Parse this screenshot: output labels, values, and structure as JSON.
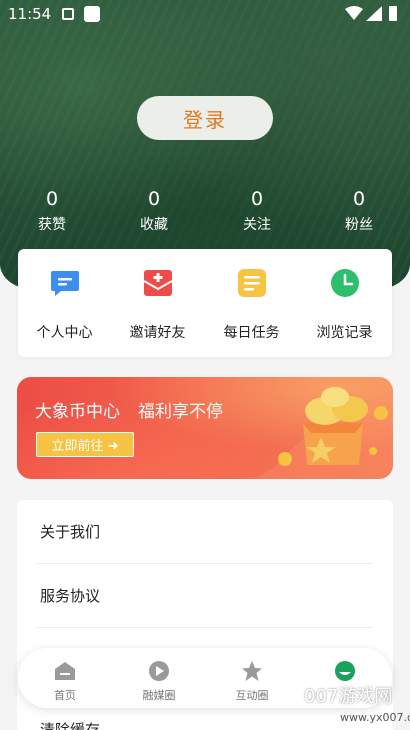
{
  "status_bar": {
    "time": "11:54"
  },
  "header": {
    "login_label": "登录",
    "stats": [
      {
        "value": "0",
        "label": "获赞"
      },
      {
        "value": "0",
        "label": "收藏"
      },
      {
        "value": "0",
        "label": "关注"
      },
      {
        "value": "0",
        "label": "粉丝"
      }
    ]
  },
  "shortcuts": [
    {
      "label": "个人中心",
      "icon": "message-icon",
      "color": "#3c8ef0"
    },
    {
      "label": "邀请好友",
      "icon": "gift-icon",
      "color": "#ef4b4b"
    },
    {
      "label": "每日任务",
      "icon": "task-list-icon",
      "color": "#f6c342"
    },
    {
      "label": "浏览记录",
      "icon": "clock-icon",
      "color": "#2bbf6b"
    }
  ],
  "banner": {
    "title": "大象币中心",
    "subtitle": "福利享不停",
    "button_label": "立即前往 ➜"
  },
  "menu": {
    "items": [
      {
        "label": "关于我们"
      },
      {
        "label": "服务协议"
      },
      {
        "label": ""
      },
      {
        "label": "清除缓存"
      }
    ]
  },
  "tabbar": {
    "tabs": [
      {
        "label": "首页",
        "icon": "home-icon"
      },
      {
        "label": "融媒圈",
        "icon": "play-icon"
      },
      {
        "label": "互动圈",
        "icon": "star-icon"
      },
      {
        "label": "",
        "icon": "profile-icon",
        "active": true
      }
    ]
  },
  "watermark": {
    "text": "007游戏网",
    "url": "www.yx007.com"
  },
  "colors": {
    "accent": "#e07a1c",
    "active_tab": "#1aa15a",
    "banner": "#ec4d45"
  }
}
